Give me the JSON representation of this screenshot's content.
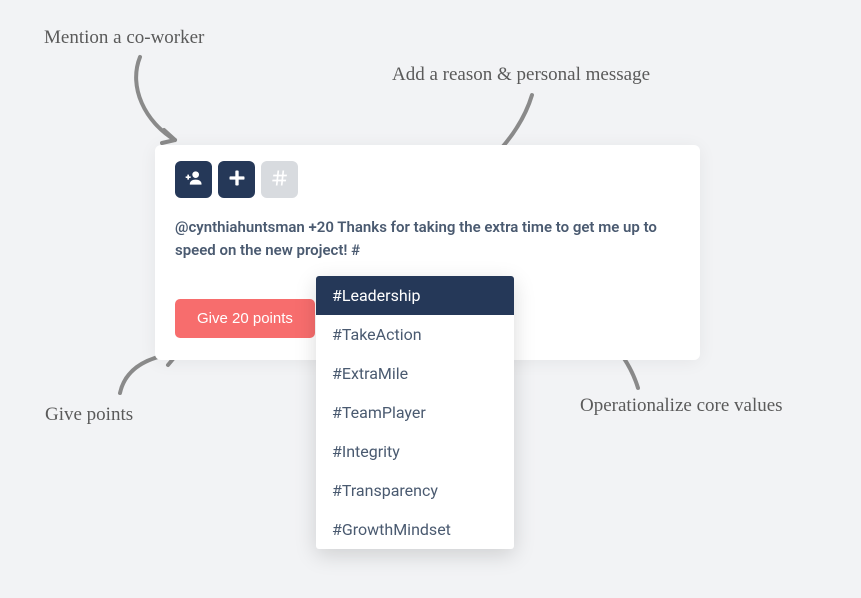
{
  "annotations": {
    "mention": "Mention a co-worker",
    "reason": "Add a reason & personal message",
    "give_points": "Give points",
    "core_values": "Operationalize core values"
  },
  "card": {
    "message": "@cynthiahuntsman +20 Thanks for taking the extra time to get me up to speed on the new project! #",
    "button_label": "Give 20 points"
  },
  "icons": {
    "add_person": "add-person-icon",
    "plus": "plus-icon",
    "hash": "hash-icon"
  },
  "dropdown": {
    "items": [
      "#Leadership",
      "#TakeAction",
      "#ExtraMile",
      "#TeamPlayer",
      "#Integrity",
      "#Transparency",
      "#GrowthMindset"
    ],
    "selected_index": 0
  }
}
